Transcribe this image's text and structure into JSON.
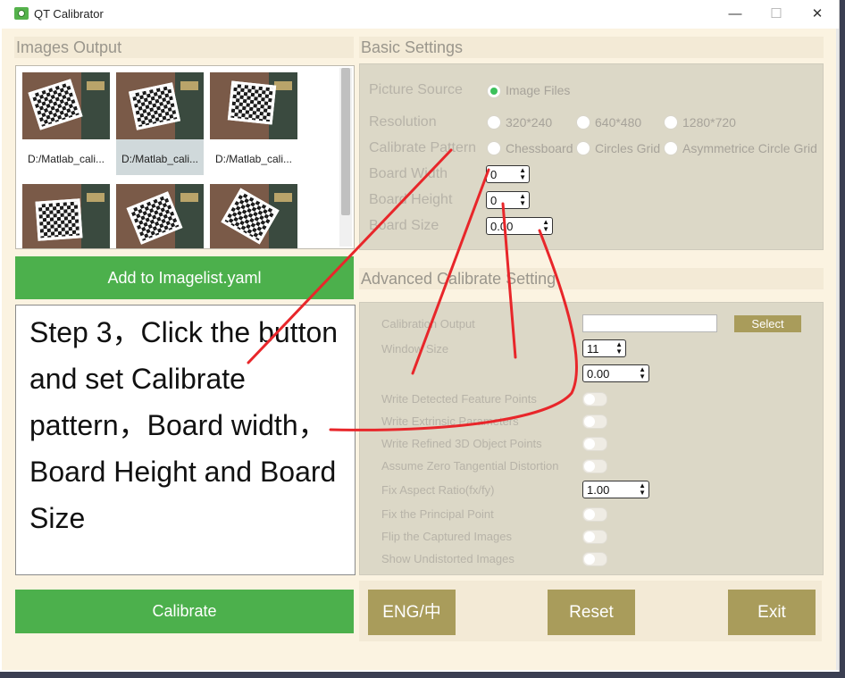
{
  "window": {
    "title": "QT Calibrator",
    "minimize": "—",
    "maximize": "☐",
    "close": "✕"
  },
  "left": {
    "images_header": "Images Output",
    "thumbnails": [
      {
        "label": "D:/Matlab_cali..."
      },
      {
        "label": "D:/Matlab_cali..."
      },
      {
        "label": "D:/Matlab_cali..."
      },
      {
        "label": ""
      },
      {
        "label": ""
      },
      {
        "label": ""
      }
    ],
    "add_button": "Add to Imagelist.yaml",
    "step_text": "Step 3，Click the button and set Calibrate pattern，Board width，Board Height and Board Size",
    "calibrate_button": "Calibrate"
  },
  "basic": {
    "header": "Basic Settings",
    "picture_source_label": "Picture Source",
    "picture_source_option": "Image Files",
    "resolution_label": "Resolution",
    "resolution_options": [
      "320*240",
      "640*480",
      "1280*720"
    ],
    "pattern_label": "Calibrate Pattern",
    "pattern_options": [
      "Chessboard",
      "Circles Grid",
      "Asymmetrice Circle Grid"
    ],
    "board_width_label": "Board Width",
    "board_width_value": "0",
    "board_height_label": "Board Height",
    "board_height_value": "0",
    "board_size_label": "Board Size",
    "board_size_value": "0.00"
  },
  "advanced": {
    "header": "Advanced Calibrate Setting",
    "calibration_output_label": "Calibration Output",
    "select_button": "Select",
    "window_size_label": "Window Size",
    "window_size_value": "11",
    "param_value": "0.00",
    "toggles": [
      "Write Detected Feature Points",
      "Write Extrinsic Parameters",
      "Write Refined 3D Object Points",
      "Assume Zero Tangential Distortion"
    ],
    "aspect_label": "Fix Aspect Ratio(fx/fy)",
    "aspect_value": "1.00",
    "toggles2": [
      "Fix the Principal Point",
      "Flip the Captured Images",
      "Show Undistorted Images"
    ]
  },
  "bottom": {
    "lang_button": "ENG/中",
    "reset_button": "Reset",
    "exit_button": "Exit"
  },
  "colors": {
    "green": "#4cb04c",
    "olive": "#a99c5b",
    "annotation": "#e8262a",
    "radio_on": "#3cc15b"
  }
}
